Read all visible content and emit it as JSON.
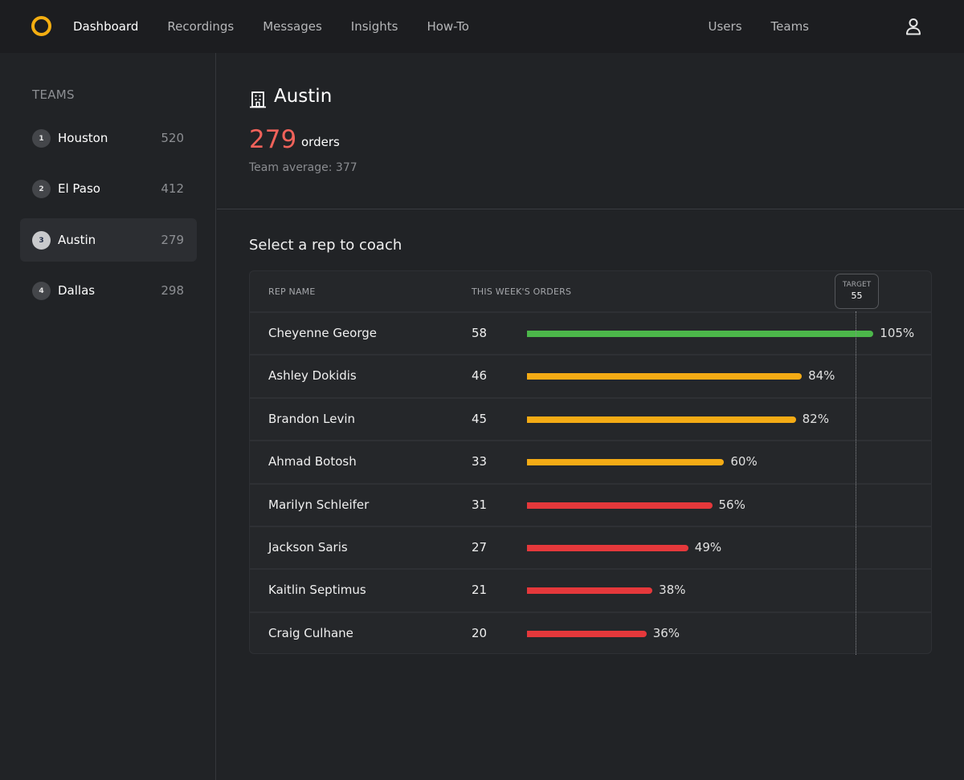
{
  "nav": {
    "left_items": [
      {
        "label": "Dashboard",
        "active": true
      },
      {
        "label": "Recordings",
        "active": false
      },
      {
        "label": "Messages",
        "active": false
      },
      {
        "label": "Insights",
        "active": false
      },
      {
        "label": "How-To",
        "active": false
      }
    ],
    "right_items": [
      {
        "label": "Users"
      },
      {
        "label": "Teams"
      }
    ],
    "logo_icon": "ring-logo-icon",
    "user_icon": "user-icon"
  },
  "sidebar": {
    "title": "TEAMS",
    "teams": [
      {
        "rank": "1",
        "name": "Houston",
        "count": "520",
        "active": false
      },
      {
        "rank": "2",
        "name": "El Paso",
        "count": "412",
        "active": false
      },
      {
        "rank": "3",
        "name": "Austin",
        "count": "279",
        "active": true
      },
      {
        "rank": "4",
        "name": "Dallas",
        "count": "298",
        "active": false
      }
    ]
  },
  "header": {
    "icon": "building-icon",
    "team_name": "Austin",
    "orders": "279",
    "orders_label": "orders",
    "team_average": "Team average: 377"
  },
  "coach": {
    "title": "Select a rep to coach",
    "columns": {
      "name": "REP NAME",
      "orders": "THIS WEEK'S ORDERS"
    },
    "target": {
      "label": "TARGET",
      "value": 55
    },
    "colors": {
      "above": "#4cb74a",
      "mid": "#f4ab15",
      "low": "#e5383b"
    },
    "reps": [
      {
        "name": "Cheyenne George",
        "orders": 58,
        "pct": "105%",
        "status": "above"
      },
      {
        "name": "Ashley Dokidis",
        "orders": 46,
        "pct": "84%",
        "status": "mid"
      },
      {
        "name": "Brandon Levin",
        "orders": 45,
        "pct": "82%",
        "status": "mid"
      },
      {
        "name": "Ahmad Botosh",
        "orders": 33,
        "pct": "60%",
        "status": "mid"
      },
      {
        "name": "Marilyn Schleifer",
        "orders": 31,
        "pct": "56%",
        "status": "low"
      },
      {
        "name": "Jackson Saris",
        "orders": 27,
        "pct": "49%",
        "status": "low"
      },
      {
        "name": "Kaitlin Septimus",
        "orders": 21,
        "pct": "38%",
        "status": "low"
      },
      {
        "name": "Craig Culhane",
        "orders": 20,
        "pct": "36%",
        "status": "low"
      }
    ]
  }
}
